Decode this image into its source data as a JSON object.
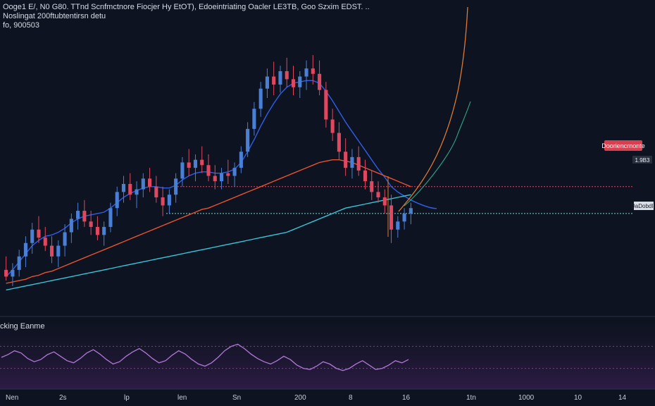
{
  "header": {
    "line1": "Ooge1 E/, N0 G80. TTnd Scnfmctnore Fiocjer Hy EtOT), Edoeintriating Oacler LE3TB, Goo Szxim EDST. ..",
    "line2": "Noslingat 200ftubtentirsn detu",
    "line3": "fo, 900503"
  },
  "price_labels": {
    "current": "Dooriencrnonte",
    "current_axis": "1.9B3",
    "secondary_axis": "DaDobdIa"
  },
  "indicator": {
    "title": "cking Eanme"
  },
  "x_axis": {
    "labels": [
      "Nen",
      "2s",
      "lp",
      "len",
      "Sn",
      "200",
      "8",
      "16",
      "1tn",
      "1000",
      "10",
      "14"
    ]
  },
  "colors": {
    "background": "#0d1320",
    "up_candle": "#4a7fd6",
    "down_candle": "#e0485f",
    "ma_fast": "#2f5fe8",
    "ma_mid": "#e8532f",
    "ma_slow": "#39c6d8",
    "ma_projection": "#e07a2f",
    "ma_projection_green": "#2fa887",
    "oscillator": "#b078d6",
    "resistance_line": "#e0485f",
    "support_line": "#7fd6c8"
  },
  "chart_data": {
    "type": "candlestick",
    "grid": false,
    "candles": [
      [
        1.0,
        1.1,
        0.92,
        0.95
      ],
      [
        0.95,
        1.05,
        0.88,
        1.0
      ],
      [
        1.0,
        1.15,
        0.95,
        1.1
      ],
      [
        1.1,
        1.25,
        1.02,
        1.2
      ],
      [
        1.2,
        1.35,
        1.12,
        1.3
      ],
      [
        1.3,
        1.4,
        1.2,
        1.24
      ],
      [
        1.24,
        1.32,
        1.14,
        1.18
      ],
      [
        1.18,
        1.25,
        1.05,
        1.1
      ],
      [
        1.1,
        1.22,
        1.02,
        1.18
      ],
      [
        1.18,
        1.34,
        1.1,
        1.28
      ],
      [
        1.28,
        1.42,
        1.2,
        1.38
      ],
      [
        1.38,
        1.5,
        1.3,
        1.44
      ],
      [
        1.44,
        1.52,
        1.32,
        1.36
      ],
      [
        1.36,
        1.44,
        1.26,
        1.32
      ],
      [
        1.32,
        1.4,
        1.22,
        1.26
      ],
      [
        1.26,
        1.36,
        1.18,
        1.32
      ],
      [
        1.32,
        1.5,
        1.28,
        1.46
      ],
      [
        1.46,
        1.62,
        1.4,
        1.58
      ],
      [
        1.58,
        1.7,
        1.5,
        1.64
      ],
      [
        1.64,
        1.72,
        1.52,
        1.56
      ],
      [
        1.56,
        1.66,
        1.46,
        1.6
      ],
      [
        1.6,
        1.72,
        1.54,
        1.68
      ],
      [
        1.68,
        1.76,
        1.58,
        1.62
      ],
      [
        1.62,
        1.7,
        1.5,
        1.54
      ],
      [
        1.54,
        1.62,
        1.4,
        1.48
      ],
      [
        1.48,
        1.6,
        1.42,
        1.56
      ],
      [
        1.56,
        1.72,
        1.5,
        1.68
      ],
      [
        1.68,
        1.84,
        1.62,
        1.8
      ],
      [
        1.8,
        1.9,
        1.7,
        1.76
      ],
      [
        1.76,
        1.86,
        1.66,
        1.82
      ],
      [
        1.82,
        1.92,
        1.72,
        1.78
      ],
      [
        1.78,
        1.86,
        1.66,
        1.7
      ],
      [
        1.7,
        1.78,
        1.6,
        1.66
      ],
      [
        1.66,
        1.76,
        1.6,
        1.72
      ],
      [
        1.72,
        1.82,
        1.64,
        1.7
      ],
      [
        1.7,
        1.8,
        1.62,
        1.76
      ],
      [
        1.76,
        1.92,
        1.72,
        1.88
      ],
      [
        1.88,
        2.1,
        1.84,
        2.05
      ],
      [
        2.05,
        2.25,
        2.0,
        2.2
      ],
      [
        2.2,
        2.4,
        2.14,
        2.35
      ],
      [
        2.35,
        2.5,
        2.28,
        2.44
      ],
      [
        2.44,
        2.55,
        2.3,
        2.38
      ],
      [
        2.38,
        2.52,
        2.32,
        2.48
      ],
      [
        2.48,
        2.58,
        2.36,
        2.42
      ],
      [
        2.42,
        2.52,
        2.3,
        2.36
      ],
      [
        2.36,
        2.48,
        2.28,
        2.44
      ],
      [
        2.44,
        2.56,
        2.34,
        2.5
      ],
      [
        2.5,
        2.6,
        2.38,
        2.46
      ],
      [
        2.46,
        2.56,
        2.3,
        2.34
      ],
      [
        2.34,
        2.4,
        2.06,
        2.12
      ],
      [
        2.12,
        2.2,
        1.96,
        2.02
      ],
      [
        2.02,
        2.1,
        1.82,
        1.88
      ],
      [
        1.88,
        1.98,
        1.7,
        1.76
      ],
      [
        1.76,
        1.9,
        1.68,
        1.84
      ],
      [
        1.84,
        1.92,
        1.7,
        1.74
      ],
      [
        1.74,
        1.82,
        1.6,
        1.66
      ],
      [
        1.66,
        1.74,
        1.52,
        1.58
      ],
      [
        1.58,
        1.66,
        1.5,
        1.54
      ],
      [
        1.54,
        1.6,
        1.42,
        1.48
      ],
      [
        1.48,
        1.56,
        1.2,
        1.3
      ],
      [
        1.3,
        1.4,
        1.24,
        1.36
      ],
      [
        1.36,
        1.46,
        1.3,
        1.42
      ],
      [
        1.42,
        1.5,
        1.34,
        1.46
      ]
    ],
    "moving_averages": [
      {
        "values": [
          0.95,
          1.0,
          1.06,
          1.12,
          1.18,
          1.22,
          1.25,
          1.26,
          1.28,
          1.31,
          1.35,
          1.38,
          1.4,
          1.41,
          1.42,
          1.43,
          1.46,
          1.5,
          1.54,
          1.57,
          1.59,
          1.61,
          1.62,
          1.62,
          1.61,
          1.61,
          1.63,
          1.67,
          1.7,
          1.72,
          1.73,
          1.73,
          1.72,
          1.72,
          1.73,
          1.75,
          1.8,
          1.88,
          1.97,
          2.07,
          2.16,
          2.24,
          2.31,
          2.36,
          2.39,
          2.4,
          2.41,
          2.41,
          2.39,
          2.33,
          2.26,
          2.18,
          2.1,
          2.03,
          1.96,
          1.89,
          1.82,
          1.75,
          1.69,
          1.62,
          1.58,
          1.55,
          1.52
        ]
      },
      {
        "values": [
          0.9,
          0.91,
          0.92,
          0.93,
          0.95,
          0.96,
          0.98,
          0.99,
          1.01,
          1.03,
          1.05,
          1.07,
          1.09,
          1.11,
          1.13,
          1.15,
          1.17,
          1.19,
          1.21,
          1.23,
          1.25,
          1.27,
          1.29,
          1.31,
          1.33,
          1.35,
          1.37,
          1.39,
          1.41,
          1.43,
          1.45,
          1.46,
          1.48,
          1.5,
          1.52,
          1.54,
          1.56,
          1.58,
          1.6,
          1.62,
          1.64,
          1.66,
          1.68,
          1.7,
          1.72,
          1.74,
          1.76,
          1.78,
          1.8,
          1.81,
          1.82,
          1.82,
          1.81,
          1.8,
          1.78,
          1.76,
          1.74,
          1.72,
          1.7,
          1.68,
          1.66,
          1.64,
          1.62
        ]
      },
      {
        "values": [
          0.85,
          0.86,
          0.87,
          0.88,
          0.89,
          0.9,
          0.91,
          0.92,
          0.93,
          0.94,
          0.95,
          0.96,
          0.97,
          0.98,
          0.99,
          1.0,
          1.01,
          1.02,
          1.03,
          1.04,
          1.05,
          1.06,
          1.07,
          1.08,
          1.09,
          1.1,
          1.11,
          1.12,
          1.13,
          1.14,
          1.15,
          1.16,
          1.17,
          1.18,
          1.19,
          1.2,
          1.21,
          1.22,
          1.23,
          1.24,
          1.25,
          1.26,
          1.27,
          1.28,
          1.3,
          1.32,
          1.34,
          1.36,
          1.38,
          1.4,
          1.42,
          1.44,
          1.46,
          1.47,
          1.48,
          1.49,
          1.5,
          1.51,
          1.52,
          1.53,
          1.54,
          1.55,
          1.56
        ]
      }
    ],
    "levels": [
      1.62,
      1.42
    ],
    "oscillator": [
      50,
      55,
      62,
      58,
      48,
      42,
      46,
      55,
      60,
      52,
      44,
      40,
      48,
      58,
      64,
      56,
      46,
      38,
      42,
      52,
      60,
      66,
      58,
      48,
      40,
      44,
      54,
      62,
      56,
      46,
      38,
      34,
      40,
      50,
      62,
      70,
      74,
      66,
      56,
      48,
      42,
      38,
      44,
      52,
      46,
      36,
      30,
      28,
      34,
      42,
      38,
      30,
      26,
      30,
      38,
      44,
      36,
      28,
      30,
      36,
      44,
      40,
      46
    ],
    "ylim": [
      0.7,
      2.8
    ]
  }
}
